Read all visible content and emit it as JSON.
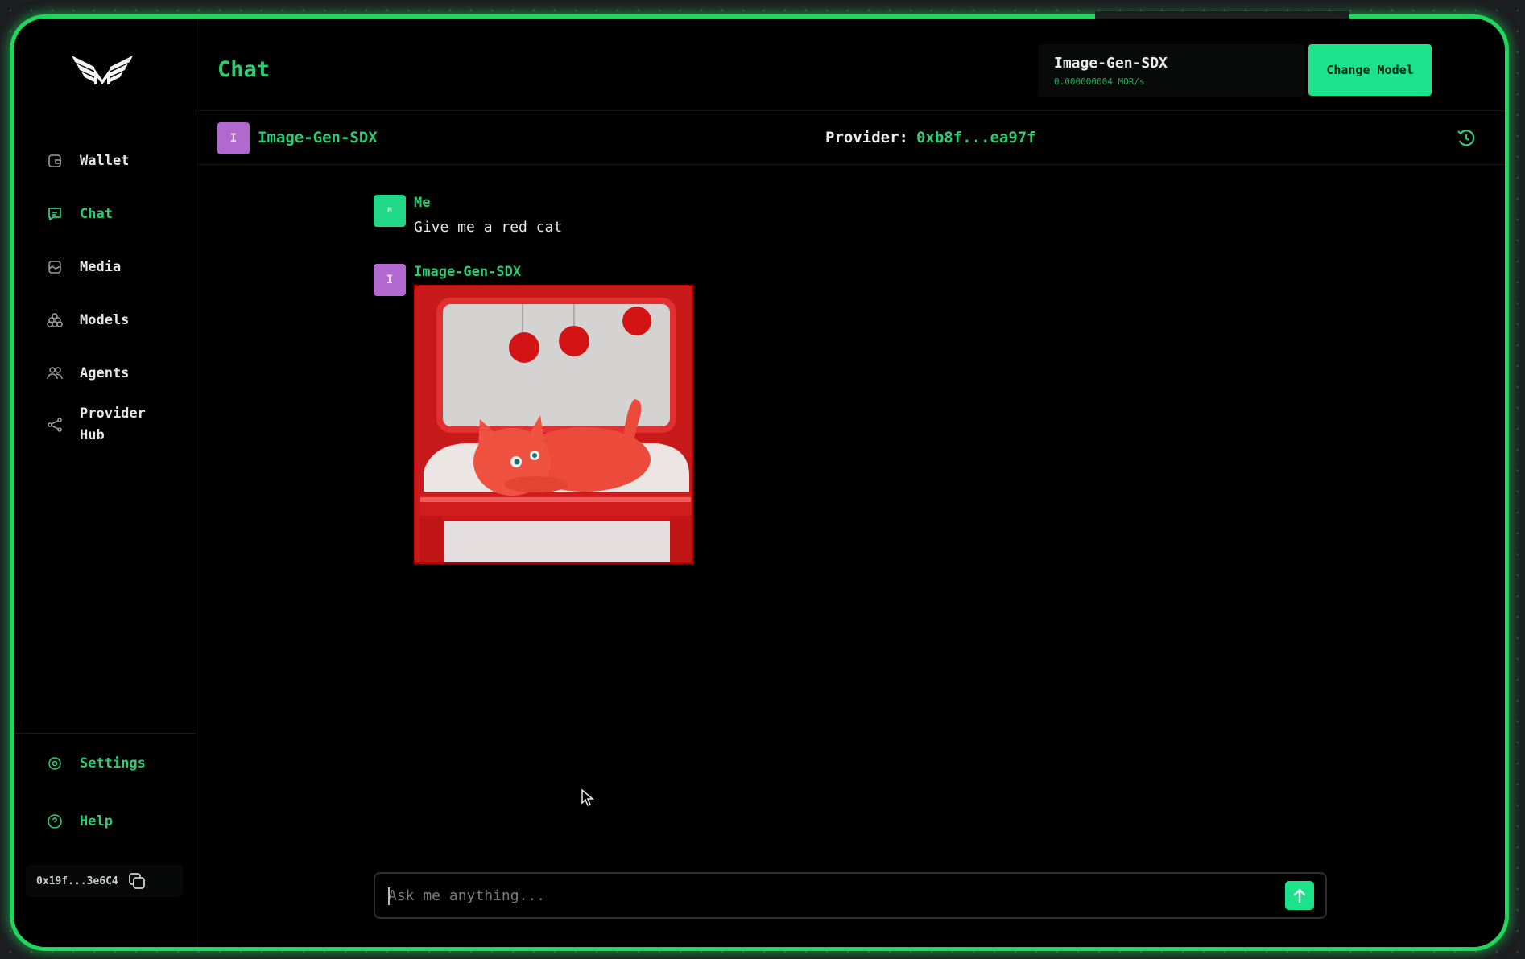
{
  "app": {
    "logo": "morpheus-wings-logo"
  },
  "sidebar": {
    "items": [
      {
        "label": "Wallet",
        "icon": "wallet-icon",
        "active": false
      },
      {
        "label": "Chat",
        "icon": "chat-icon",
        "active": true
      },
      {
        "label": "Media",
        "icon": "media-icon",
        "active": false
      },
      {
        "label": "Models",
        "icon": "models-icon",
        "active": false
      },
      {
        "label": "Agents",
        "icon": "agents-icon",
        "active": false
      },
      {
        "label_line1": "Provider",
        "label_line2": "Hub",
        "icon": "provider-hub-icon",
        "active": false
      }
    ],
    "footer": [
      {
        "label": "Settings",
        "icon": "gear-icon"
      },
      {
        "label": "Help",
        "icon": "help-icon"
      }
    ],
    "wallet_address": "0x19f...3e6C4"
  },
  "header": {
    "title": "Chat",
    "current_model": {
      "name": "Image-Gen-SDX",
      "rate": "0.000000004 MOR/s"
    },
    "change_model_label": "Change Model"
  },
  "model_bar": {
    "avatar_letter": "I",
    "model_name": "Image-Gen-SDX",
    "provider_label": "Provider:",
    "provider_address": "0xb8f...ea97f"
  },
  "messages": [
    {
      "author": "Me",
      "avatar_letter": "M",
      "text": "Give me a red cat"
    },
    {
      "author": "Image-Gen-SDX",
      "avatar_letter": "I",
      "image": "generated image of a red cat lying on a white cushion on a red chair"
    }
  ],
  "input": {
    "placeholder": "Ask me anything...",
    "value": ""
  },
  "colors": {
    "accent": "#2ecc71",
    "button": "#1de28c",
    "model_avatar": "#b269cf",
    "frame_glow": "#1fd65a"
  }
}
